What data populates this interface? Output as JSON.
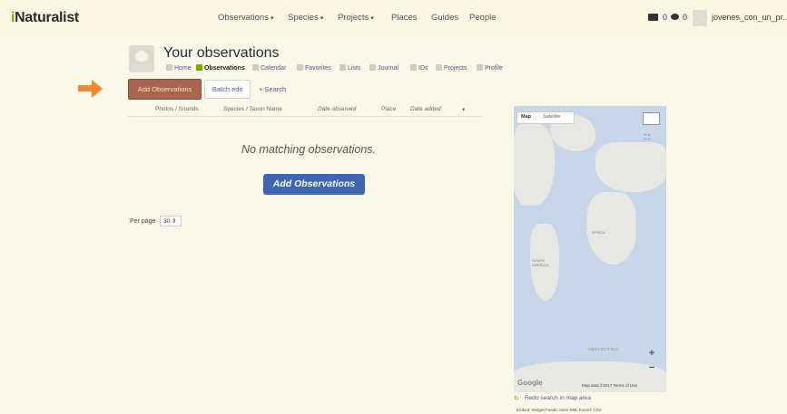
{
  "app": {
    "logo_prefix": "i",
    "logo_rest": "Naturalist"
  },
  "nav": {
    "items": [
      {
        "label": "Observations",
        "has_menu": true
      },
      {
        "label": "Species",
        "has_menu": true
      },
      {
        "label": "Projects",
        "has_menu": true
      },
      {
        "label": "Places",
        "has_menu": false
      },
      {
        "label": "Guides",
        "has_menu": false
      },
      {
        "label": "People",
        "has_menu": false
      }
    ],
    "messages_count": "0",
    "notifications_count": "0",
    "username": "jovenes_con_un_pr..."
  },
  "header": {
    "title": "Your observations",
    "subnav": [
      {
        "label": "Home"
      },
      {
        "label": "Observations",
        "active": true
      },
      {
        "label": "Calendar"
      },
      {
        "label": "Favorites"
      },
      {
        "label": "Lists"
      },
      {
        "label": "Journal"
      },
      {
        "label": "IDs"
      },
      {
        "label": "Projects"
      },
      {
        "label": "Profile"
      }
    ]
  },
  "actions": {
    "add_label": "Add Observations",
    "batch_label": "Batch edit",
    "search_label": "+ Search"
  },
  "table": {
    "columns": [
      "Photos / Sounds",
      "Species / Taxon Name",
      "Date observed",
      "Place",
      "Date added"
    ],
    "sort_indicator": "▾",
    "empty_message": "No matching observations.",
    "empty_button": "Add Observations"
  },
  "pagination": {
    "per_page_label": "Per page",
    "per_page_value": "30"
  },
  "map": {
    "tabs": {
      "map": "Map",
      "satellite": "Satellite"
    },
    "labels": {
      "africa": "AFRICA",
      "south_america": "SOUTH AMERICA",
      "antarctica": "ANTARCTICA"
    },
    "zoom_in": "+",
    "zoom_out": "−",
    "google": "Google",
    "attribution": "Map data ©2017   Terms of Use",
    "redo_search": "Redo search in map area",
    "footer": "Embed: Widget   Feeds: Atom   KML   Export: CSV"
  },
  "colors": {
    "accent_orange": "#f28a2e",
    "primary_blue": "#3f66b3",
    "add_button": "#a9644c"
  }
}
